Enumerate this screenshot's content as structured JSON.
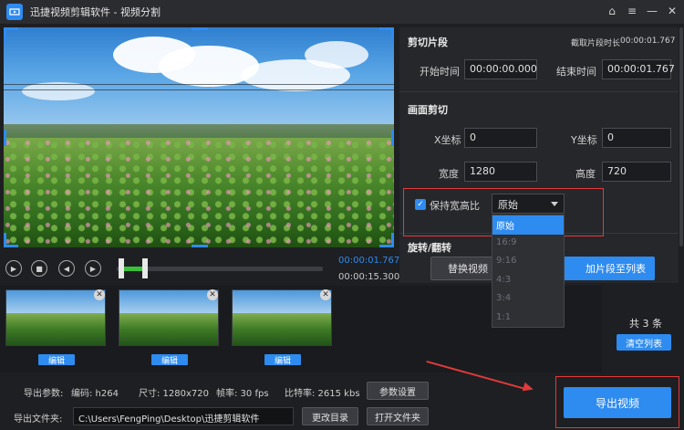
{
  "app": {
    "title": "迅捷视频剪辑软件 - 视频分割"
  },
  "window_icons": [
    "home-icon",
    "menu-icon",
    "minimize-icon",
    "close-icon"
  ],
  "playback": {
    "current_time": "00:00:01.767",
    "total_time": "00:00:15.300"
  },
  "cut_section": {
    "title": "剪切片段",
    "duration_label": "截取片段时长",
    "duration_value": "00:00:01.767",
    "start_label": "开始时间",
    "start_value": "00:00:00.000",
    "end_label": "结束时间",
    "end_value": "00:00:01.767"
  },
  "crop_section": {
    "title": "画面剪切",
    "x_label": "X坐标",
    "x_value": "0",
    "y_label": "Y坐标",
    "y_value": "0",
    "width_label": "宽度",
    "width_value": "1280",
    "height_label": "高度",
    "height_value": "720",
    "keep_ratio_label": "保持宽高比",
    "keep_ratio_checked": true,
    "ratio_selected": "原始",
    "ratio_options": [
      "原始",
      "16:9",
      "9:16",
      "4:3",
      "3:4",
      "1:1"
    ]
  },
  "rotate_section": {
    "title": "旋转/翻转",
    "replace_video": "替换视频",
    "add_to_list": "加片段至列表"
  },
  "clips": {
    "edit_label": "编辑",
    "count_text": "共 3 条",
    "clear_list": "清空列表",
    "items": [
      {
        "edit": "编辑"
      },
      {
        "edit": "编辑"
      },
      {
        "edit": "编辑"
      }
    ]
  },
  "export": {
    "params_label": "导出参数:",
    "codec": "编码: h264",
    "size": "尺寸: 1280x720",
    "fps": "帧率: 30 fps",
    "bitrate": "比特率: 2615 kbs",
    "param_settings": "参数设置",
    "folder_label": "导出文件夹:",
    "folder_path": "C:\\Users\\FengPing\\Desktop\\迅捷剪辑软件",
    "change_dir": "更改目录",
    "open_folder": "打开文件夹",
    "export_button": "导出视频"
  },
  "colors": {
    "accent": "#2e8bef",
    "highlight_red": "#e03a3a",
    "progress_green": "#39c039"
  }
}
